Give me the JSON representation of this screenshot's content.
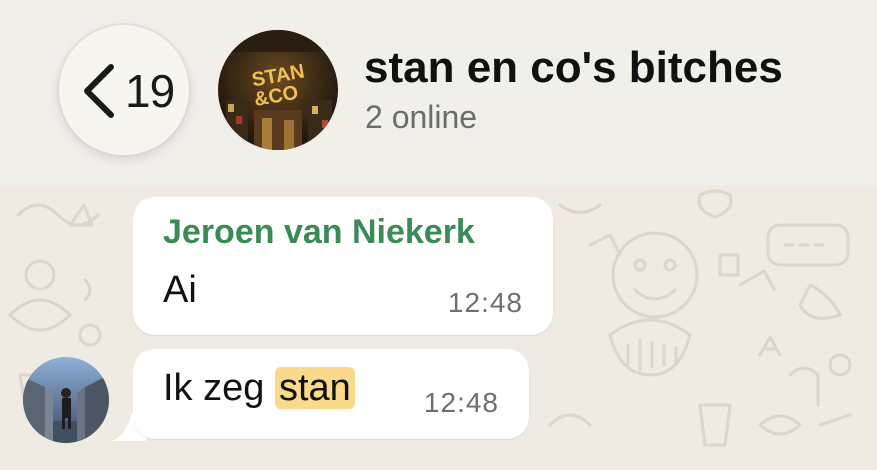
{
  "header": {
    "back_count": "19",
    "back_icon": "chevron-left-icon",
    "group_name": "stan en co's bitches",
    "group_status": "2 online",
    "avatar_logo_line1": "STAN",
    "avatar_logo_line2": "&CO"
  },
  "messages": [
    {
      "sender": "Jeroen van Niekerk",
      "text": "Ai",
      "time": "12:48"
    },
    {
      "text_prefix": "Ik zeg ",
      "text_highlight": "stan",
      "time": "12:48"
    }
  ],
  "colors": {
    "sender_name": "#3b8b57",
    "highlight": "#f9d98c",
    "header_bg": "#f1efea",
    "chat_bg": "#efeae2"
  }
}
